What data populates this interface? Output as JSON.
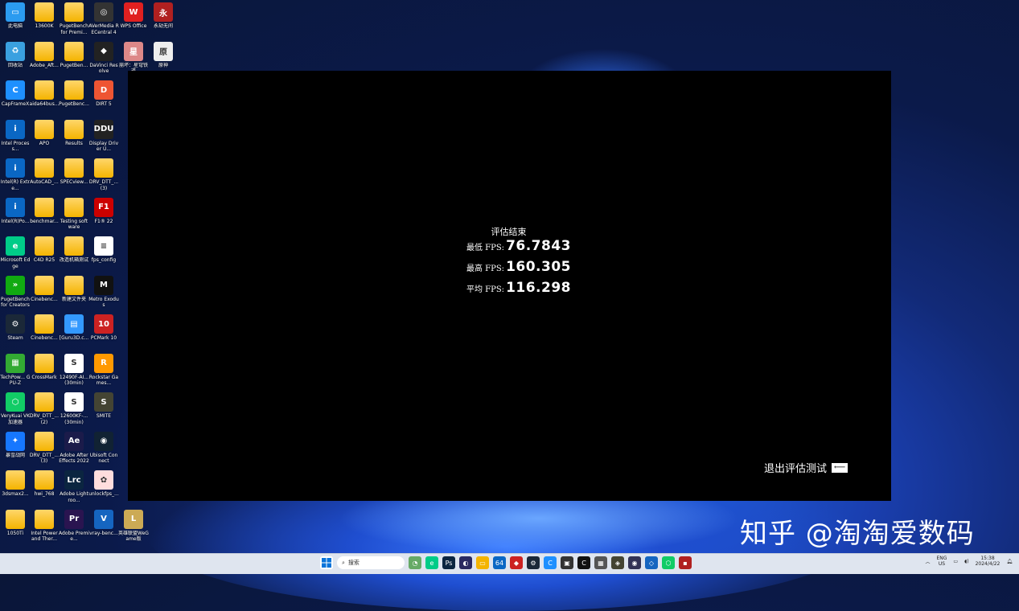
{
  "desktop": {
    "icons": [
      {
        "label": "此电脑",
        "color": "#2b9bf0",
        "glyph": "▭"
      },
      {
        "label": "13600K",
        "color": "folder",
        "glyph": ""
      },
      {
        "label": "PugetBench for Premi...",
        "color": "folder",
        "glyph": ""
      },
      {
        "label": "AVerMedia RECentral 4",
        "color": "#333",
        "glyph": "◎"
      },
      {
        "label": "WPS Office",
        "color": "#e02020",
        "glyph": "W"
      },
      {
        "label": "永劫无间",
        "color": "#b02020",
        "glyph": "永"
      },
      {
        "label": "回收站",
        "color": "#3aa0e0",
        "glyph": "♻"
      },
      {
        "label": "Adobe_Aft...",
        "color": "folder",
        "glyph": ""
      },
      {
        "label": "PugetBen...",
        "color": "folder",
        "glyph": ""
      },
      {
        "label": "DaVinci Resolve",
        "color": "#222",
        "glyph": "◆"
      },
      {
        "label": "崩坏：星穹铁道",
        "color": "#d88",
        "glyph": "星"
      },
      {
        "label": "原神",
        "color": "#eee",
        "glyph": "原"
      },
      {
        "label": "CapFrameX",
        "color": "#1e90ff",
        "glyph": "C"
      },
      {
        "label": "aida64bus...",
        "color": "folder",
        "glyph": ""
      },
      {
        "label": "PugetBenc...",
        "color": "folder",
        "glyph": ""
      },
      {
        "label": "DIRT 5",
        "color": "#e53",
        "glyph": "D"
      },
      {
        "label": "Intel Process...",
        "color": "#0a67c4",
        "glyph": "i"
      },
      {
        "label": "APO",
        "color": "folder",
        "glyph": ""
      },
      {
        "label": "Results",
        "color": "folder",
        "glyph": ""
      },
      {
        "label": "Display Driver U...",
        "color": "#222",
        "glyph": "DDU"
      },
      {
        "label": "Intel(R) Extre...",
        "color": "#0a67c4",
        "glyph": "i"
      },
      {
        "label": "AutoCAD_...",
        "color": "folder",
        "glyph": ""
      },
      {
        "label": "SPECview...",
        "color": "folder",
        "glyph": ""
      },
      {
        "label": "DRV_DTT_... (3)",
        "color": "folder",
        "glyph": ""
      },
      {
        "label": "Intel(R)Po...",
        "color": "#0a67c4",
        "glyph": "i"
      },
      {
        "label": "benchmar...",
        "color": "folder",
        "glyph": ""
      },
      {
        "label": "Testing software",
        "color": "folder",
        "glyph": ""
      },
      {
        "label": "F1® 22",
        "color": "#c00",
        "glyph": "F1"
      },
      {
        "label": "Microsoft Edge",
        "color": "#0c8",
        "glyph": "e"
      },
      {
        "label": "C4D R25",
        "color": "folder",
        "glyph": ""
      },
      {
        "label": "改造机箱测试",
        "color": "folder",
        "glyph": ""
      },
      {
        "label": "fps_config",
        "color": "#fff",
        "glyph": "≡"
      },
      {
        "label": "PugetBench for Creators",
        "color": "#1a1",
        "glyph": "»"
      },
      {
        "label": "Cinebenc...",
        "color": "folder",
        "glyph": ""
      },
      {
        "label": "新建文件夹",
        "color": "folder",
        "glyph": ""
      },
      {
        "label": "Metro Exodus",
        "color": "#111",
        "glyph": "M"
      },
      {
        "label": "Steam",
        "color": "#1b2838",
        "glyph": "⚙"
      },
      {
        "label": "Cinebenc...",
        "color": "folder",
        "glyph": ""
      },
      {
        "label": "[Guru3D.c...",
        "color": "#39f",
        "glyph": "▤"
      },
      {
        "label": "PCMark 10",
        "color": "#c22",
        "glyph": "10"
      },
      {
        "label": "TechPow... GPU-Z",
        "color": "#3a3",
        "glyph": "▦"
      },
      {
        "label": "CrossMark",
        "color": "folder",
        "glyph": ""
      },
      {
        "label": "12490F-AI... (30min)",
        "color": "#fff",
        "glyph": "S"
      },
      {
        "label": "Rockstar Games...",
        "color": "#f90",
        "glyph": "R"
      },
      {
        "label": "VeryKuai VK 加速器",
        "color": "#1c6",
        "glyph": "⬡"
      },
      {
        "label": "DRV_DTT_... (2)",
        "color": "folder",
        "glyph": ""
      },
      {
        "label": "12600KF-... (30min)",
        "color": "#fff",
        "glyph": "S"
      },
      {
        "label": "SMITE",
        "color": "#443",
        "glyph": "S"
      },
      {
        "label": "暴雪战网",
        "color": "#1677ff",
        "glyph": "✦"
      },
      {
        "label": "DRV_DTT_... (3)",
        "color": "folder",
        "glyph": ""
      },
      {
        "label": "Adobe After Effects 2022",
        "color": "#1b1b4a",
        "glyph": "Ae"
      },
      {
        "label": "Ubisoft Connect",
        "color": "#123",
        "glyph": "◉"
      },
      {
        "label": "3dsmax2...",
        "color": "folder",
        "glyph": ""
      },
      {
        "label": "hwi_768",
        "color": "folder",
        "glyph": ""
      },
      {
        "label": "Adobe Lightroo...",
        "color": "#0b2540",
        "glyph": "Lrc"
      },
      {
        "label": "unlockfps_...",
        "color": "#fdd",
        "glyph": "✿"
      },
      {
        "label": "1050Ti",
        "color": "folder",
        "glyph": ""
      },
      {
        "label": "Intel Power and Ther...",
        "color": "folder",
        "glyph": ""
      },
      {
        "label": "Adobe Premie...",
        "color": "#2a1450",
        "glyph": "Pr"
      },
      {
        "label": "vray-benc...",
        "color": "#1565c0",
        "glyph": "V"
      },
      {
        "label": "英雄联盟WeGame版",
        "color": "#ccaa55",
        "glyph": "L"
      }
    ]
  },
  "app": {
    "title": "评估结束",
    "rows": [
      {
        "label": "最低 FPS:",
        "value": "76.7843"
      },
      {
        "label": "最高 FPS:",
        "value": "160.305"
      },
      {
        "label": "平均 FPS:",
        "value": "116.298"
      }
    ],
    "exit_label": "退出评估测试",
    "exit_arrow": "⟵"
  },
  "watermark": "知乎 @淘淘爱数码",
  "taskbar": {
    "search_placeholder": "搜索",
    "apps": [
      {
        "name": "widgets-icon",
        "color": "#6a6",
        "glyph": "◔"
      },
      {
        "name": "edge-icon",
        "color": "#0c8",
        "glyph": "e"
      },
      {
        "name": "photoshop-icon",
        "color": "#0b2540",
        "glyph": "Ps"
      },
      {
        "name": "browser-icon",
        "color": "#2a2a60",
        "glyph": "◐"
      },
      {
        "name": "file-explorer-icon",
        "color": "#f4b400",
        "glyph": "▭"
      },
      {
        "name": "aida64-icon",
        "color": "#0a67c4",
        "glyph": "64"
      },
      {
        "name": "game-icon",
        "color": "#c22",
        "glyph": "◆"
      },
      {
        "name": "steam-icon",
        "color": "#1b2838",
        "glyph": "⚙"
      },
      {
        "name": "capframex-icon",
        "color": "#1e90ff",
        "glyph": "C"
      },
      {
        "name": "monitor-icon",
        "color": "#333",
        "glyph": "▣"
      },
      {
        "name": "cpuz-icon",
        "color": "#111",
        "glyph": "C"
      },
      {
        "name": "calc-icon",
        "color": "#555",
        "glyph": "▦"
      },
      {
        "name": "app-icon",
        "color": "#443",
        "glyph": "◈"
      },
      {
        "name": "app2-icon",
        "color": "#335",
        "glyph": "◉"
      },
      {
        "name": "shield-icon",
        "color": "#1565c0",
        "glyph": "◇"
      },
      {
        "name": "vk-icon",
        "color": "#1c6",
        "glyph": "⬡"
      },
      {
        "name": "game-window-icon",
        "color": "#b02020",
        "glyph": "▪"
      }
    ],
    "lang": "ENG",
    "region": "US",
    "time": "15:38",
    "date": "2024/4/22"
  }
}
